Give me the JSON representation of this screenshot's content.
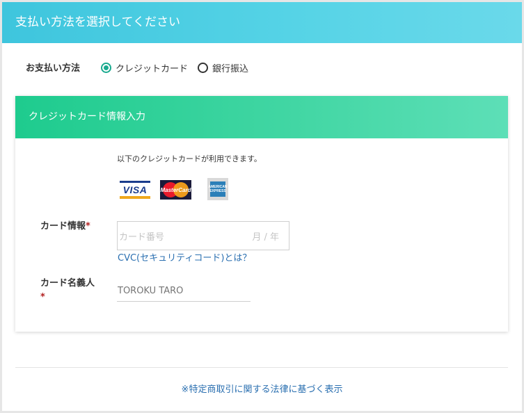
{
  "header": {
    "title": "支払い方法を選択してください"
  },
  "payment_method": {
    "label": "お支払い方法",
    "options": [
      {
        "label": "クレジットカード",
        "selected": true
      },
      {
        "label": "銀行振込",
        "selected": false
      }
    ]
  },
  "card_section": {
    "title": "クレジットカード情報入力",
    "available_text": "以下のクレジットカードが利用できます。",
    "brands": [
      {
        "name": "VISA",
        "icon": "visa-logo-icon"
      },
      {
        "name": "MasterCard",
        "icon": "mastercard-logo-icon"
      },
      {
        "name": "AMERICAN EXPRESS",
        "icon": "amex-logo-icon"
      }
    ],
    "card_info": {
      "label": "カード情報",
      "required_mark": "*",
      "number_placeholder": "カード番号",
      "expiry_placeholder": "月 / 年",
      "cvc_link": "CVC(セキュリティコード)とは？"
    },
    "card_name": {
      "label": "カード名義人",
      "required_mark": "*",
      "placeholder": "TOROKU TARO"
    }
  },
  "footer": {
    "link": "※特定商取引に関する法律に基づく表示"
  },
  "colors": {
    "header_gradient": [
      "#3ec5dd",
      "#6ad9ea"
    ],
    "section_gradient": [
      "#1ecb8e",
      "#5ddfb7"
    ],
    "radio_accent": "#1aaa8f",
    "link": "#2a6fb0",
    "required": "#b22222"
  }
}
